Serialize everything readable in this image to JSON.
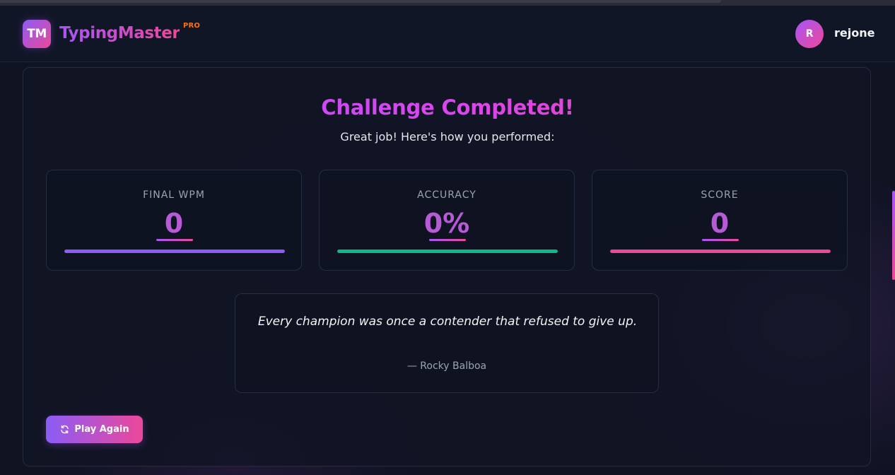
{
  "header": {
    "logo_initials": "TM",
    "brand_name": "TypingMaster",
    "pro_label": "PRO",
    "user_initial": "R",
    "username": "rejone"
  },
  "results": {
    "title": "Challenge Completed!",
    "subtitle": "Great job! Here's how you performed:",
    "stats": [
      {
        "label": "FINAL WPM",
        "value": "0",
        "bar_color": "#8b5cf6",
        "bar_fill_fraction": 1.0
      },
      {
        "label": "ACCURACY",
        "value": "0%",
        "bar_color": "#10b981",
        "bar_fill_fraction": 1.0
      },
      {
        "label": "SCORE",
        "value": "0",
        "bar_color": "#ec4899",
        "bar_fill_fraction": 1.0
      }
    ]
  },
  "quote": {
    "text": "Every champion was once a contender that refused to give up.",
    "author": "— Rocky Balboa"
  },
  "actions": {
    "play_again_label": "Play Again",
    "play_again_icon": "refresh-icon"
  },
  "colors": {
    "background": "#0f1322",
    "accent_purple": "#a855f7",
    "accent_pink": "#ec4899",
    "accent_orange": "#f97316",
    "accent_green": "#10b981"
  }
}
